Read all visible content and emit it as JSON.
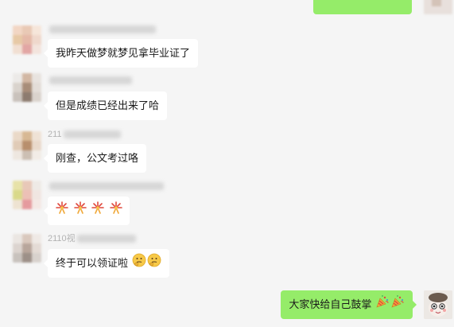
{
  "chat": {
    "messages": [
      {
        "sender_name": "",
        "text": "我昨天做梦就梦见拿毕业证了",
        "emojis": []
      },
      {
        "sender_name": "",
        "text": "但是成绩已经出来了哈",
        "emojis": []
      },
      {
        "sender_name": "211",
        "text": "刚查，公文考过咯",
        "emojis": []
      },
      {
        "sender_name": "",
        "text": "",
        "emojis": [
          "firework-icon",
          "firework-icon",
          "firework-icon",
          "firework-icon"
        ]
      },
      {
        "sender_name": "2110视",
        "text": "终于可以领证啦",
        "emojis": [
          "thinking-face-icon",
          "thinking-face-icon"
        ]
      },
      {
        "sender_name": "",
        "text": "大家快给自己鼓掌",
        "emojis": [
          "party-popper-icon",
          "party-popper-icon"
        ],
        "from_me": true
      }
    ]
  },
  "colors": {
    "background": "#f5f5f5",
    "bubble_other": "#ffffff",
    "bubble_me": "#95ec69",
    "name_text": "#b2b2b2"
  }
}
